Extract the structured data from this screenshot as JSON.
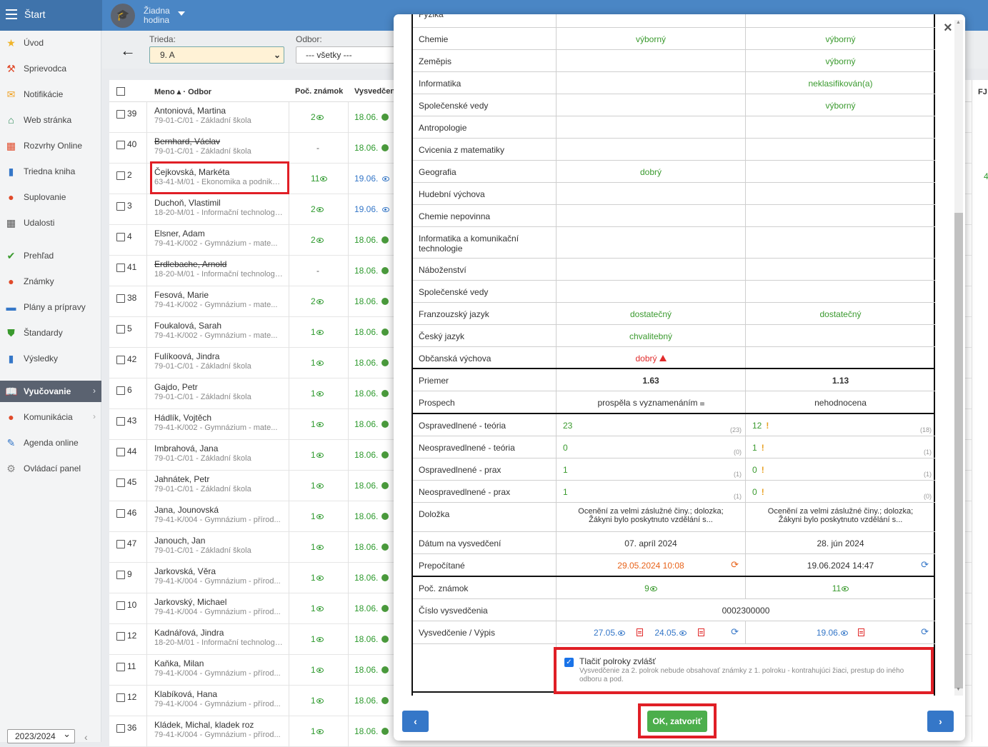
{
  "topbar": {
    "brand": "Štart",
    "lesson_line1": "Žiadna",
    "lesson_line2": "hodina"
  },
  "sidebar": {
    "items": [
      {
        "label": "Úvod",
        "icon": "star-icon",
        "color": "#f0b429"
      },
      {
        "label": "Sprievodca",
        "icon": "magic-wand-icon",
        "color": "#e04a2a"
      },
      {
        "label": "Notifikácie",
        "icon": "envelope-icon",
        "color": "#f0a020"
      },
      {
        "label": "Web stránka",
        "icon": "home-icon",
        "color": "#2e8b57"
      },
      {
        "label": "Rozvrhy Online",
        "icon": "calendar-grid-icon",
        "color": "#e04a2a"
      },
      {
        "label": "Triedna kniha",
        "icon": "book-icon",
        "color": "#3577c8"
      },
      {
        "label": "Suplovanie",
        "icon": "user-icon",
        "color": "#e04a2a"
      },
      {
        "label": "Udalosti",
        "icon": "calendar-icon",
        "color": "#555555"
      },
      {
        "label": "Prehľad",
        "icon": "check-circle-icon",
        "color": "#3a9a2e"
      },
      {
        "label": "Známky",
        "icon": "grades-icon",
        "color": "#e04a2a"
      },
      {
        "label": "Plány a prípravy",
        "icon": "briefcase-icon",
        "color": "#3577c8"
      },
      {
        "label": "Štandardy",
        "icon": "shield-check-icon",
        "color": "#3a9a2e"
      },
      {
        "label": "Výsledky",
        "icon": "bar-chart-icon",
        "color": "#3577c8"
      },
      {
        "label": "Vyučovanie",
        "icon": "open-book-icon",
        "color": "#ffffff"
      },
      {
        "label": "Komunikácia",
        "icon": "chat-icon",
        "color": "#e04a2a"
      },
      {
        "label": "Agenda online",
        "icon": "pen-icon",
        "color": "#3577c8"
      },
      {
        "label": "Ovládací panel",
        "icon": "gear-icon",
        "color": "#888888"
      }
    ],
    "year": "2023/2024"
  },
  "filters": {
    "trieda_label": "Trieda:",
    "trieda_value": "9. A",
    "odbor_label": "Odbor:",
    "odbor_value": "--- všetky ---"
  },
  "grid": {
    "headers": {
      "meno": "Meno ▴ · Odbor",
      "count": "Poč. známok",
      "vysv": "Vysvedčen",
      "fj": "FJ"
    },
    "rows": [
      {
        "num": "39",
        "name": "Antoniová, Martina",
        "odbor": "79-01-C/01 - Základní škola",
        "count": "2",
        "date": "18.06."
      },
      {
        "num": "40",
        "name": "Bernhard, Václav",
        "odbor": "79-01-C/01 - Základní škola",
        "count": "-",
        "date": "18.06."
      },
      {
        "num": "2",
        "name": "Čejkovská, Markéta",
        "odbor": "63-41-M/01 - Ekonomika a podniká...",
        "count": "11",
        "date": "19.06."
      },
      {
        "num": "3",
        "name": "Duchoň, Vlastimil",
        "odbor": "18-20-M/01 - Informační technologi...",
        "count": "2",
        "date": "19.06."
      },
      {
        "num": "4",
        "name": "Elsner, Adam",
        "odbor": "79-41-K/002 - Gymnázium - mate...",
        "count": "2",
        "date": "18.06."
      },
      {
        "num": "41",
        "name": "Erdlebache, Arnold",
        "odbor": "18-20-M/01 - Informační technologi...",
        "count": "-",
        "date": "18.06."
      },
      {
        "num": "38",
        "name": "Fesová, Marie",
        "odbor": "79-41-K/002 - Gymnázium - mate...",
        "count": "2",
        "date": "18.06."
      },
      {
        "num": "5",
        "name": "Foukalová, Sarah",
        "odbor": "79-41-K/002 - Gymnázium - mate...",
        "count": "1",
        "date": "18.06."
      },
      {
        "num": "42",
        "name": "Fulíkoová, Jindra",
        "odbor": "79-01-C/01 - Základní škola",
        "count": "1",
        "date": "18.06."
      },
      {
        "num": "6",
        "name": "Gajdo, Petr",
        "odbor": "79-01-C/01 - Základní škola",
        "count": "1",
        "date": "18.06."
      },
      {
        "num": "43",
        "name": "Hádlík, Vojtěch",
        "odbor": "79-41-K/002 - Gymnázium - mate...",
        "count": "1",
        "date": "18.06."
      },
      {
        "num": "44",
        "name": "Imbrahová, Jana",
        "odbor": "79-01-C/01 - Základní škola",
        "count": "1",
        "date": "18.06."
      },
      {
        "num": "45",
        "name": "Jahnátek, Petr",
        "odbor": "79-01-C/01 - Základní škola",
        "count": "1",
        "date": "18.06."
      },
      {
        "num": "46",
        "name": "Jana, Jounovská",
        "odbor": "79-41-K/004 - Gymnázium - přírod...",
        "count": "1",
        "date": "18.06."
      },
      {
        "num": "47",
        "name": "Janouch, Jan",
        "odbor": "79-01-C/01 - Základní škola",
        "count": "1",
        "date": "18.06."
      },
      {
        "num": "9",
        "name": "Jarkovská, Věra",
        "odbor": "79-41-K/004 - Gymnázium - přírod...",
        "count": "1",
        "date": "18.06."
      },
      {
        "num": "10",
        "name": "Jarkovský, Michael",
        "odbor": "79-41-K/004 - Gymnázium - přírod...",
        "count": "1",
        "date": "18.06."
      },
      {
        "num": "12",
        "name": "Kadnářová, Jindra",
        "odbor": "18-20-M/01 - Informační technologi...",
        "count": "1",
        "date": "18.06."
      },
      {
        "num": "11",
        "name": "Kaňka, Milan",
        "odbor": "79-41-K/004 - Gymnázium - přírod...",
        "count": "1",
        "date": "18.06."
      },
      {
        "num": "12",
        "name": "Klabíková, Hana",
        "odbor": "79-41-K/004 - Gymnázium - přírod...",
        "count": "1",
        "date": "18.06."
      },
      {
        "num": "36",
        "name": "Kládek, Michal, kladek roz",
        "odbor": "79-41-K/004 - Gymnázium - přírod...",
        "count": "1",
        "date": "18.06."
      }
    ],
    "right_extra": "4"
  },
  "modal": {
    "subjects": [
      {
        "name": "Fyzika",
        "v1": "",
        "v2": ""
      },
      {
        "name": "Chemie",
        "v1": "výborný",
        "v2": "výborný"
      },
      {
        "name": "Zeměpis",
        "v1": "",
        "v2": "výborný"
      },
      {
        "name": "Informatika",
        "v1": "",
        "v2": "neklasifikován(a)"
      },
      {
        "name": "Společenské vedy",
        "v1": "",
        "v2": "výborný"
      },
      {
        "name": "Antropologie",
        "v1": "",
        "v2": ""
      },
      {
        "name": "Cvicenia z matematiky",
        "v1": "",
        "v2": ""
      },
      {
        "name": "Geografia",
        "v1": "dobrý",
        "v2": ""
      },
      {
        "name": "Hudební výchova",
        "v1": "",
        "v2": ""
      },
      {
        "name": "Chemie nepovinna",
        "v1": "",
        "v2": ""
      },
      {
        "name": "Informatika a komunikační technologie",
        "v1": "",
        "v2": ""
      },
      {
        "name": "Náboženství",
        "v1": "",
        "v2": ""
      },
      {
        "name": "Společenské vedy",
        "v1": "",
        "v2": ""
      },
      {
        "name": "Franzouzský jazyk",
        "v1": "dostatečný",
        "v2": "dostatečný"
      },
      {
        "name": "Český jazyk",
        "v1": "chvalitebný",
        "v2": ""
      },
      {
        "name": "Občanská výchova",
        "v1": "dobrý",
        "v2": ""
      }
    ],
    "priemer": {
      "label": "Priemer",
      "v1": "1.63",
      "v2": "1.13"
    },
    "prospech": {
      "label": "Prospech",
      "v1": "prospěla s vyznamenáním",
      "v2": "nehodnocena"
    },
    "absence": [
      {
        "label": "Ospravedlnené - teória",
        "v1": "23",
        "s1": "(23)",
        "v2": "12",
        "s2": "(18)"
      },
      {
        "label": "Neospravedlnené - teória",
        "v1": "0",
        "s1": "(0)",
        "v2": "1",
        "s2": "(1)"
      },
      {
        "label": "Ospravedlnené - prax",
        "v1": "1",
        "s1": "(1)",
        "v2": "0",
        "s2": "(1)"
      },
      {
        "label": "Neospravedlnené - prax",
        "v1": "1",
        "s1": "(1)",
        "v2": "0",
        "s2": "(0)"
      }
    ],
    "dolozka": {
      "label": "Doložka",
      "v1a": "Ocenění za velmi záslužné činy.; dolozka;",
      "v1b": "Žákyni bylo poskytnuto vzdělání s...",
      "v2a": "Ocenění za velmi záslužné činy.; dolozka;",
      "v2b": "Žákyni bylo poskytnuto vzdělání s..."
    },
    "datum": {
      "label": "Dátum na vysvedčení",
      "v1": "07. apríl 2024",
      "v2": "28. jún 2024"
    },
    "prepocitane": {
      "label": "Prepočítané",
      "v1": "29.05.2024 10:08",
      "v2": "19.06.2024 14:47"
    },
    "poc_znamok": {
      "label": "Poč. známok",
      "v1": "9",
      "v2": "11"
    },
    "cislo": {
      "label": "Číslo vysvedčenia",
      "v": "0002300000"
    },
    "vysv": {
      "label": "Vysvedčenie / Výpis",
      "d1": "27.05.",
      "d2": "24.05.",
      "d3": "19.06."
    },
    "print": {
      "label": "Tlačiť polroky zvlášť",
      "hint": "Vysvedčenie za 2. polrok nebude obsahovať známky z 1. polroku - kontrahujúci žiaci, prestup do iného odboru a pod."
    },
    "ok": "OK, zatvoriť",
    "prev": "‹",
    "next": "›",
    "close": "×"
  }
}
